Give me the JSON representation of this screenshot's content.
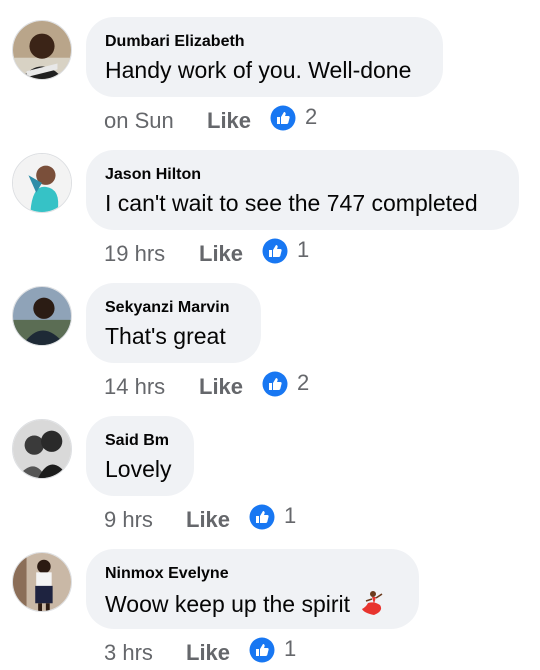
{
  "comments": [
    {
      "author": "Dumbari Elizabeth",
      "text": "Handy work of you. Well-done",
      "time": "on Sun",
      "like_label": "Like",
      "reaction_count": "2"
    },
    {
      "author": "Jason Hilton",
      "text": "I can't wait to see the 747 completed",
      "time": "19 hrs",
      "like_label": "Like",
      "reaction_count": "1"
    },
    {
      "author": "Sekyanzi Marvin",
      "text": "That's great",
      "time": "14 hrs",
      "like_label": "Like",
      "reaction_count": "2"
    },
    {
      "author": "Said Bm",
      "text": "Lovely",
      "time": "9 hrs",
      "like_label": "Like",
      "reaction_count": "1"
    },
    {
      "author": "Ninmox Evelyne",
      "text": "Woow keep up the spirit",
      "time": "3 hrs",
      "like_label": "Like",
      "reaction_count": "1",
      "emoji": "dancer-emoji"
    }
  ],
  "colors": {
    "bubble_bg": "#f0f2f5",
    "meta_text": "#65676b",
    "like_blue": "#1877f2"
  },
  "icons": {
    "reaction": "like-reaction-icon",
    "avatar": "profile-avatar"
  }
}
